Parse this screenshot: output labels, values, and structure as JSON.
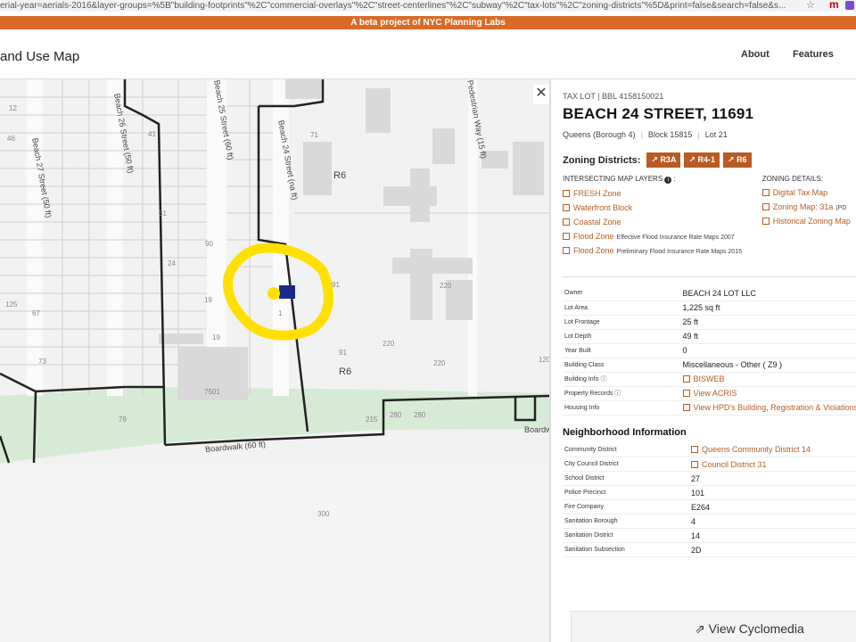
{
  "browser": {
    "url": "erial-year=aerials-2016&layer-groups=%5B\"building-footprints\"%2C\"commercial-overlays\"%2C\"street-centerlines\"%2C\"subway\"%2C\"tax-lots\"%2C\"zoning-districts\"%5D&print=false&search=false&s...",
    "star_icon": "star-icon",
    "extension_label": "m"
  },
  "banner": {
    "text": "A beta project of NYC Planning Labs"
  },
  "header": {
    "title": "and Use Map",
    "nav": [
      "About",
      "Features"
    ]
  },
  "map": {
    "street_labels": [
      "Beach 27 Street  (50 ft)",
      "Beach 26 Street  (50 ft)",
      "Beach 25 Street  (60 ft)",
      "Beach 24 Street  (na ft)",
      "Pedestrian Way  (15 ft)",
      "Boardwalk  (60 ft)",
      "Boardw"
    ],
    "zone_labels": [
      "R6",
      "R6"
    ],
    "lot_numbers": [
      "41",
      "31",
      "24",
      "90",
      "19",
      "19",
      "7501",
      "79",
      "1",
      "91",
      "91",
      "220",
      "220",
      "220",
      "280",
      "280",
      "215",
      "300",
      "73",
      "67",
      "71",
      "46",
      "125",
      "12",
      "120"
    ],
    "close_label": "✕"
  },
  "panel": {
    "lot_type": "TAX LOT | BBL 4158150021",
    "title": "BEACH 24 STREET, 11691",
    "borough": "Queens (Borough 4)",
    "block": "Block 15815",
    "lot": "Lot 21",
    "zoning_label": "Zoning Districts:",
    "zoning_badges": [
      "R3A",
      "R4-1",
      "R6"
    ],
    "layers_header": "INTERSECTING MAP LAYERS",
    "layers_header_suffix": ":",
    "layers": [
      {
        "label": "FRESH Zone",
        "note": ""
      },
      {
        "label": "Waterfront Block",
        "note": ""
      },
      {
        "label": "Coastal Zone",
        "note": ""
      },
      {
        "label": "Flood Zone",
        "note": "Effective Flood Insurance Rate Maps 2007"
      },
      {
        "label": "Flood Zone",
        "note": "Preliminary Flood Insurance Rate Maps 2015"
      }
    ],
    "details_header": "ZONING DETAILS:",
    "details": [
      {
        "label": "Digital Tax Map",
        "note": ""
      },
      {
        "label": "Zoning Map: 31a",
        "note": "(PD"
      },
      {
        "label": "Historical Zoning Map",
        "note": ""
      }
    ],
    "lot_info": [
      {
        "key": "Owner",
        "value": "BEACH 24 LOT LLC",
        "link": false
      },
      {
        "key": "Lot Area",
        "value": "1,225 sq ft",
        "link": false
      },
      {
        "key": "Lot Frontage",
        "value": "25 ft",
        "link": false
      },
      {
        "key": "Lot Depth",
        "value": "49 ft",
        "link": false
      },
      {
        "key": "Year Built",
        "value": "0",
        "link": false
      },
      {
        "key": "Building Class",
        "value": "Miscellaneous - Other ( Z9 )",
        "link": false
      },
      {
        "key": "Building Info",
        "value": "BISWEB",
        "link": true
      },
      {
        "key": "Property Records",
        "value": "View ACRIS",
        "link": true
      },
      {
        "key": "Housing Info",
        "value": "View HPD's Building, Registration & Violations",
        "link": true
      }
    ],
    "neighborhood_header": "Neighborhood Information",
    "neighborhood": [
      {
        "key": "Community District",
        "value": "Queens Community District 14",
        "link": true
      },
      {
        "key": "City Council District",
        "value": "Council District 31",
        "link": true
      },
      {
        "key": "School District",
        "value": "27",
        "link": false
      },
      {
        "key": "Police Precinct",
        "value": "101",
        "link": false
      },
      {
        "key": "Fire Company",
        "value": "E264",
        "link": false
      },
      {
        "key": "Sanitation Borough",
        "value": "4",
        "link": false
      },
      {
        "key": "Sanitation District",
        "value": "14",
        "link": false
      },
      {
        "key": "Sanitation Subsection",
        "value": "2D",
        "link": false
      }
    ],
    "cyclomedia_label": "View Cyclomedia"
  },
  "colors": {
    "banner": "#d96b27",
    "link": "#b85c22",
    "zoning_badge": "#b85c22",
    "highlight_marker": "#ffe000",
    "selected_lot": "#1a2a8a",
    "park": "#d6ead6"
  }
}
